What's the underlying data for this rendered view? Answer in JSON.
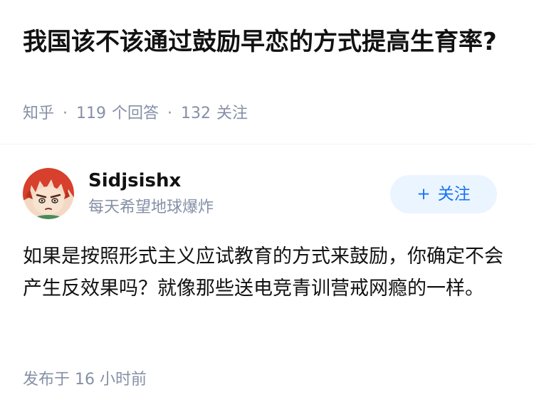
{
  "question": {
    "title": "我国该不该通过鼓励早恋的方式提高生育率?",
    "source": "知乎",
    "separator": "·",
    "answer_count": "119",
    "answer_label": "个回答",
    "follower_count": "132",
    "follower_label": "关注"
  },
  "author": {
    "name": "Sidjsishx",
    "bio": "每天希望地球爆炸",
    "avatar_icon": "anime-avatar",
    "follow_icon": "+",
    "follow_label": "关注"
  },
  "answer": {
    "content": "如果是按照形式主义应试教育的方式来鼓励，你确定不会产生反效果吗？就像那些送电竞青训营戒网瘾的一样。",
    "time": "发布于 16 小时前"
  },
  "colors": {
    "muted": "#8590a6",
    "accent": "#1772f6",
    "button_bg": "#ebf5ff"
  }
}
